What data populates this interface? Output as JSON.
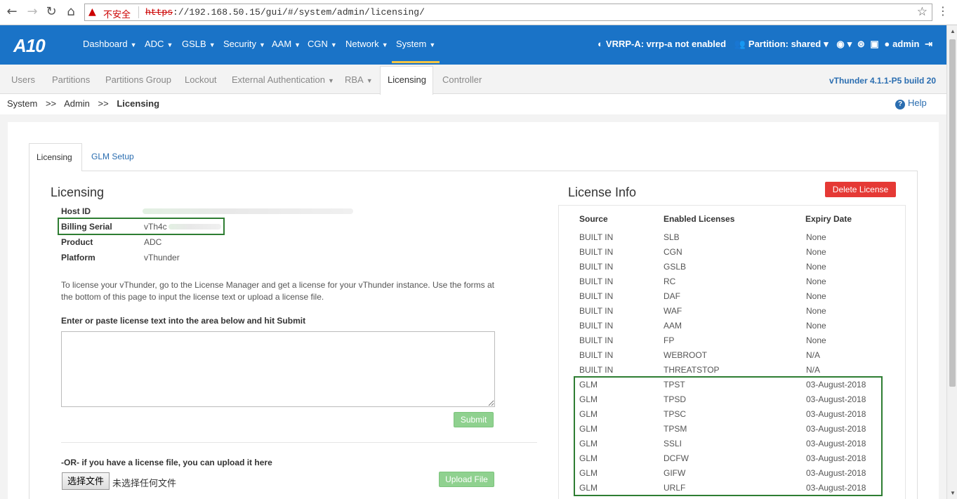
{
  "browser": {
    "insecure_label": "不安全",
    "url_scheme": "https",
    "url_rest": "://192.168.50.15/gui/#/system/admin/licensing/"
  },
  "topnav": {
    "logo": "A10",
    "menus": [
      "Dashboard",
      "ADC",
      "GSLB",
      "Security",
      "AAM",
      "CGN",
      "Network",
      "System"
    ],
    "vrrp": "VRRP-A: vrrp-a not enabled",
    "partition": "Partition: shared",
    "user": "admin"
  },
  "subnav": {
    "tabs": [
      "Users",
      "Partitions",
      "Partitions Group",
      "Lockout",
      "External Authentication",
      "RBA",
      "Licensing",
      "Controller"
    ],
    "version": "vThunder 4.1.1-P5 build 20"
  },
  "breadcrumb": {
    "a": "System",
    "sep": ">>",
    "b": "Admin",
    "c": "Licensing"
  },
  "help": "Help",
  "panel_tabs": {
    "licensing": "Licensing",
    "glm": "GLM Setup"
  },
  "licensing": {
    "title": "Licensing",
    "host_id_label": "Host ID",
    "billing_serial_label": "Billing Serial",
    "billing_serial_value": "vTh4c",
    "product_label": "Product",
    "product_value": "ADC",
    "platform_label": "Platform",
    "platform_value": "vThunder",
    "instructions": "To license your vThunder, go to the License Manager and get a license for your vThunder instance. Use the forms at the bottom of this page to input the license text or upload a license file.",
    "paste_label": "Enter or paste license text into the area below and hit Submit",
    "submit": "Submit",
    "upload_label": "-OR- if you have a license file, you can upload it here",
    "choose_file": "选择文件",
    "no_file": "未选择任何文件",
    "upload_button": "Upload File"
  },
  "license_info": {
    "title": "License Info",
    "delete_button": "Delete License",
    "headers": [
      "Source",
      "Enabled Licenses",
      "Expiry Date"
    ],
    "rows": [
      [
        "BUILT IN",
        "SLB",
        "None"
      ],
      [
        "BUILT IN",
        "CGN",
        "None"
      ],
      [
        "BUILT IN",
        "GSLB",
        "None"
      ],
      [
        "BUILT IN",
        "RC",
        "None"
      ],
      [
        "BUILT IN",
        "DAF",
        "None"
      ],
      [
        "BUILT IN",
        "WAF",
        "None"
      ],
      [
        "BUILT IN",
        "AAM",
        "None"
      ],
      [
        "BUILT IN",
        "FP",
        "None"
      ],
      [
        "BUILT IN",
        "WEBROOT",
        "N/A"
      ],
      [
        "BUILT IN",
        "THREATSTOP",
        "N/A"
      ],
      [
        "GLM",
        "TPST",
        "03-August-2018"
      ],
      [
        "GLM",
        "TPSD",
        "03-August-2018"
      ],
      [
        "GLM",
        "TPSC",
        "03-August-2018"
      ],
      [
        "GLM",
        "TPSM",
        "03-August-2018"
      ],
      [
        "GLM",
        "SSLI",
        "03-August-2018"
      ],
      [
        "GLM",
        "DCFW",
        "03-August-2018"
      ],
      [
        "GLM",
        "GIFW",
        "03-August-2018"
      ],
      [
        "GLM",
        "URLF",
        "03-August-2018"
      ]
    ]
  },
  "colors": {
    "nav_blue": "#1a73c7",
    "highlight_green": "#2e7d32",
    "delete_red": "#e53935",
    "button_green": "#8fd18f"
  }
}
